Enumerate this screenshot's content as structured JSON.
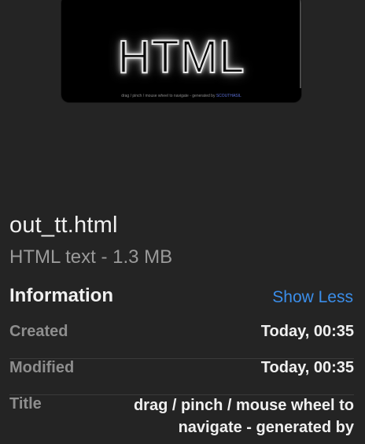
{
  "preview": {
    "word": "HTML",
    "caption": "drag / pinch / mouse wheel to navigate - generated by",
    "caption_link": "SCOUTHASIL"
  },
  "file": {
    "name": "out_tt.html",
    "kind_size": "HTML text - 1.3 MB"
  },
  "information": {
    "header": "Information",
    "toggle_label": "Show Less",
    "rows": [
      {
        "label": "Created",
        "value": "Today, 00:35"
      },
      {
        "label": "Modified",
        "value": "Today, 00:35"
      },
      {
        "label": "Title",
        "value": "drag / pinch / mouse wheel to navigate - generated by"
      }
    ]
  },
  "colors": {
    "background": "#242424",
    "accent_link": "#3b8eea",
    "label": "#8e8e8e",
    "value": "#f0f0f0"
  }
}
